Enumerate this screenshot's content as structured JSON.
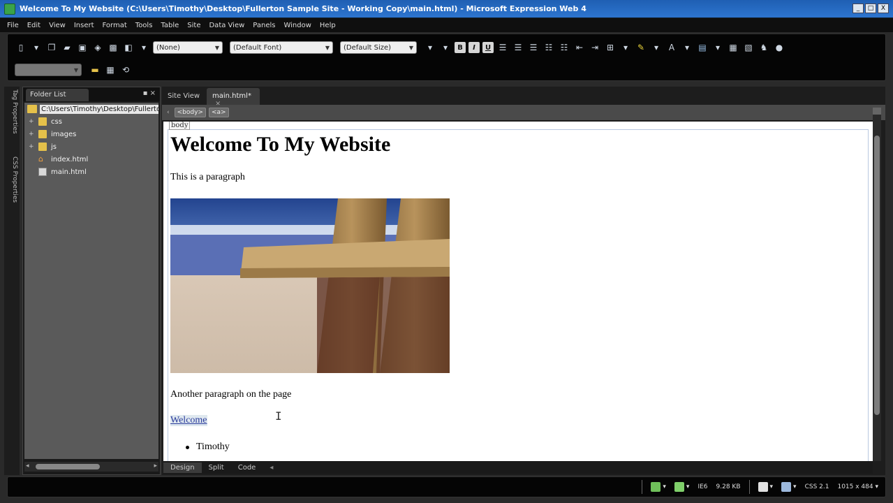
{
  "window": {
    "title": "Welcome To My Website (C:\\Users\\Timothy\\Desktop\\Fullerton Sample Site - Working Copy\\main.html) - Microsoft Expression Web 4",
    "controls": [
      "_",
      "□",
      "X"
    ]
  },
  "menu": [
    "File",
    "Edit",
    "View",
    "Insert",
    "Format",
    "Tools",
    "Table",
    "Site",
    "Data View",
    "Panels",
    "Window",
    "Help"
  ],
  "toolbar": {
    "style_dropdown": "(None)",
    "font_dropdown": "(Default Font)",
    "size_dropdown": "(Default Size)",
    "bold": "B",
    "italic": "I",
    "underline": "U"
  },
  "side_tabs": [
    "Tag Properties",
    "CSS Properties"
  ],
  "folder_panel": {
    "title": "Folder List",
    "path": "C:\\Users\\Timothy\\Desktop\\Fullerton",
    "items": [
      {
        "label": "css",
        "type": "folder",
        "expandable": true
      },
      {
        "label": "images",
        "type": "folder",
        "expandable": true
      },
      {
        "label": "js",
        "type": "folder",
        "expandable": true
      },
      {
        "label": "index.html",
        "type": "home",
        "expandable": false
      },
      {
        "label": "main.html",
        "type": "page",
        "expandable": false
      }
    ]
  },
  "doc_tabs": [
    {
      "label": "Site View",
      "active": false
    },
    {
      "label": "main.html*",
      "active": true
    }
  ],
  "quick_tags": [
    "<body>",
    "<a>"
  ],
  "page": {
    "body_tag": "body",
    "heading": "Welcome To My Website",
    "paragraph1": "This is a paragraph",
    "paragraph2": "Another paragraph on the page",
    "link": "Welcome",
    "list_items": [
      "Timothy"
    ]
  },
  "view_tabs": [
    "Design",
    "Split",
    "Code"
  ],
  "status": {
    "ie": "IE6",
    "size": "9.28 KB",
    "css": "CSS 2.1",
    "dimensions": "1015 x 484"
  },
  "colors": {
    "title_bar": "#2d75cf",
    "link": "#2a3b9c",
    "panel_bg": "#5a5a5a",
    "chrome_bg": "#050505"
  }
}
